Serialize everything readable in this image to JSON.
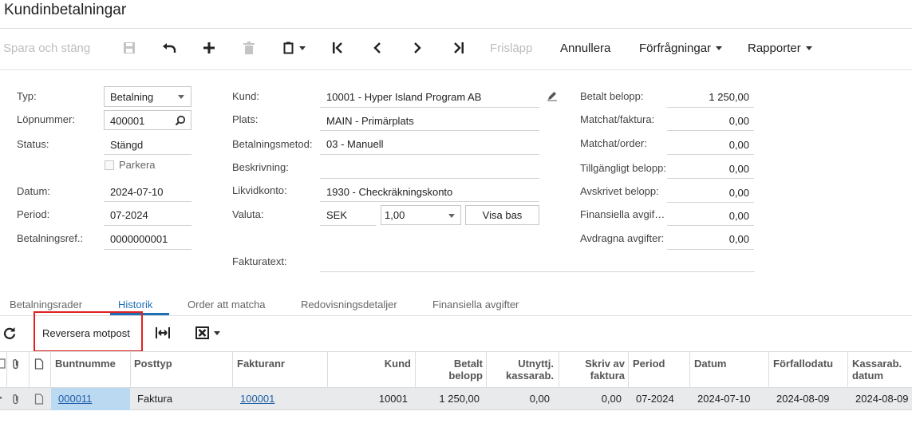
{
  "window": {
    "title": "Kundinbetalningar"
  },
  "toolbar": {
    "save_close": "Spara och stäng",
    "release": "Frisläpp",
    "cancel": "Annullera",
    "inquiries": "Förfrågningar",
    "reports": "Rapporter"
  },
  "form": {
    "type_label": "Typ:",
    "type_value": "Betalning",
    "refnbr_label": "Löpnummer:",
    "refnbr_value": "400001",
    "status_label": "Status:",
    "status_value": "Stängd",
    "hold_label": "Parkera",
    "date_label": "Datum:",
    "date_value": "2024-07-10",
    "period_label": "Period:",
    "period_value": "07-2024",
    "payref_label": "Betalningsref.:",
    "payref_value": "0000000001",
    "customer_label": "Kund:",
    "customer_value": "10001 - Hyper Island Program AB",
    "location_label": "Plats:",
    "location_value": "MAIN - Primärplats",
    "method_label": "Betalningsmetod:",
    "method_value": "03 - Manuell",
    "desc_label": "Beskrivning:",
    "desc_value": "",
    "cash_label": "Likvidkonto:",
    "cash_value": "1930 - Checkräkningskonto",
    "currency_label": "Valuta:",
    "currency_value": "SEK",
    "rate_value": "1,00",
    "view_base": "Visa bas",
    "invoice_text_label": "Fakturatext:",
    "invoice_text_value": "",
    "amounts": {
      "paid_label": "Betalt belopp:",
      "paid_value": "1 250,00",
      "matched_inv_label": "Matchat/faktura:",
      "matched_inv_value": "0,00",
      "matched_ord_label": "Matchat/order:",
      "matched_ord_value": "0,00",
      "available_label": "Tillgängligt belopp:",
      "available_value": "0,00",
      "writeoff_label": "Avskrivet belopp:",
      "writeoff_value": "0,00",
      "fin_charges_label": "Finansiella avgif…",
      "fin_charges_value": "0,00",
      "deducted_label": "Avdragna avgifter:",
      "deducted_value": "0,00"
    }
  },
  "tabs": [
    "Betalningsrader",
    "Historik",
    "Order att matcha",
    "Redovisningsdetaljer",
    "Finansiella avgifter"
  ],
  "grid_toolbar": {
    "reverse": "Reversera motpost"
  },
  "grid": {
    "headers": {
      "batch": "Buntnumme",
      "doctype": "Posttyp",
      "invoice": "Fakturanr",
      "customer": "Kund",
      "paid1": "Betalt",
      "paid2": "belopp",
      "used1": "Utnyttj.",
      "used2": "kassarab.",
      "writeoff1": "Skriv av",
      "writeoff2": "faktura",
      "period": "Period",
      "date": "Datum",
      "due": "Förfallodatu",
      "disc1": "Kassarab.",
      "disc2": "datum"
    },
    "rows": [
      {
        "batch": "000011",
        "doctype": "Faktura",
        "invoice": "100001",
        "customer": "10001",
        "paid": "1 250,00",
        "used": "0,00",
        "writeoff": "0,00",
        "period": "07-2024",
        "date": "2024-07-10",
        "due": "2024-08-09",
        "disc": "2024-08-09"
      }
    ]
  }
}
